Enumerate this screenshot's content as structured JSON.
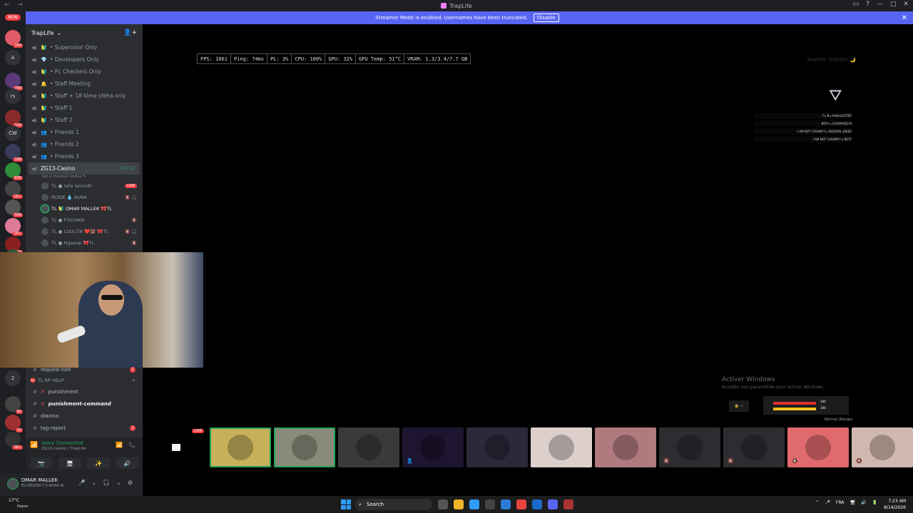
{
  "window": {
    "title": "TrapLife",
    "nav": "← →",
    "controls": [
      "▭",
      "?",
      "—",
      "□",
      "✕"
    ]
  },
  "banner": {
    "text": "Streamer Mode is enabled. Usernames have been truncated.",
    "button": "Disable",
    "close": "✕"
  },
  "guilds": {
    "new_label": "NEW",
    "items": [
      {
        "label": "",
        "badge": "164",
        "color": "#e05c6a"
      },
      {
        "label": "A",
        "badge": "",
        "color": "#313338"
      },
      {
        "label": "",
        "badge": "268",
        "color": "#5b3a7a"
      },
      {
        "label": "rs",
        "badge": "",
        "color": "#313338"
      },
      {
        "label": "",
        "badge": "326",
        "color": "#8a2a2a"
      },
      {
        "label": "CW",
        "badge": "",
        "color": "#313338"
      },
      {
        "label": "",
        "badge": "188",
        "color": "#3a3a5a"
      },
      {
        "label": "",
        "badge": "699",
        "color": "#2e8b3a"
      },
      {
        "label": "",
        "badge": "1K+",
        "color": "#444"
      },
      {
        "label": "",
        "badge": "936",
        "color": "#555"
      },
      {
        "label": "",
        "badge": "1K+",
        "color": "#e07a9a"
      },
      {
        "label": "",
        "badge": "192",
        "color": "#8a2020"
      },
      {
        "label": "",
        "badge": "",
        "color": "#2a5a3a"
      },
      {
        "label": "2",
        "badge": "",
        "color": "#313338"
      },
      {
        "label": "",
        "badge": "90",
        "color": "#444"
      },
      {
        "label": "",
        "badge": "10",
        "color": "#a03030"
      },
      {
        "label": "",
        "badge": "2K+",
        "color": "#333"
      }
    ]
  },
  "server": {
    "name": "TrapLife",
    "chevron": "⌄",
    "invite_icon": "👤+"
  },
  "voice_channels": [
    {
      "label": "Supervisor Only",
      "emoji": "🔰"
    },
    {
      "label": "Developers Only",
      "emoji": "💎"
    },
    {
      "label": "Pc Checkers Only",
      "emoji": "🔰"
    },
    {
      "label": "Staff Meeting",
      "emoji": "🔔"
    },
    {
      "label": "Staff + 18 klme sfeha only",
      "emoji": "🔰"
    },
    {
      "label": "Staff 1",
      "emoji": "🔰"
    },
    {
      "label": "Staff 2",
      "emoji": "🔰"
    },
    {
      "label": "Friends 1",
      "emoji": "👥"
    },
    {
      "label": "Friends 2",
      "emoji": "👥"
    },
    {
      "label": "Friends 3",
      "emoji": "👥"
    }
  ],
  "active_channel": {
    "label": "ZG13-Casino",
    "timer": "1:07:12",
    "status": "Set a channel status ✎"
  },
  "voice_users": [
    {
      "name": "TL ● rafa lamridh",
      "live": "LIVE",
      "mute": ""
    },
    {
      "name": "IR3DE 💧 AURA",
      "live": "",
      "mute": "🔇 🎧"
    },
    {
      "name": "TL 🔰 OMAR MALLEK 🎀TL",
      "live": "",
      "mute": "",
      "speaking": true
    },
    {
      "name": "TL ● FOCHIKA",
      "live": "",
      "mute": "🔇"
    },
    {
      "name": "TL ● LOULITA ❤️🐻 🎀TL",
      "live": "",
      "mute": "🔇 🎧"
    },
    {
      "name": "TL ● Hgaoop 🎀TL",
      "live": "",
      "mute": "🔇"
    }
  ],
  "text_channels_top": [
    {
      "label": "request-role",
      "ping": "1"
    }
  ],
  "category": {
    "label": "TL RP HELP",
    "plus": "+"
  },
  "text_channels": [
    {
      "label": "punishment",
      "x": "✕",
      "bold": false
    },
    {
      "label": "punishment-command",
      "x": "✕",
      "bold": true
    },
    {
      "label": "diwana",
      "x": "",
      "bold": false
    },
    {
      "label": "tag-report",
      "x": "",
      "bold": false,
      "ping": "2"
    }
  ],
  "voicebar": {
    "title": "Voice Connected",
    "subtitle": "ZG13-Casino / TrapLife",
    "controls": [
      "📶",
      "📞"
    ],
    "buttons": [
      "📷",
      "🖥",
      "✨",
      "🔊"
    ]
  },
  "user": {
    "name": "OMAR MALLEK",
    "status": "ELI BEZINA Y JI NHAR W...",
    "controls": [
      "🎤",
      "⌄",
      "🎧",
      "⌄",
      "⚙"
    ]
  },
  "perf": [
    "FPS: 1661",
    "Ping: 74ms",
    "PL: 3%",
    "CPU: 100%",
    "GPU: 32%",
    "GPU Temp: 51°C",
    "VRAM: 1.3/3.4/7.7 GB"
  ],
  "game": {
    "fivem": "FiveM® (b3095) 🌙",
    "logo": "⛛",
    "killfeed": [
      "F.L.B ▸ KHALILSVTER",
      "BOYY ▸ CUADRADO N",
      "-I AM NOT CASAWYY ▸ NAOUFAL JOKER",
      "-I AM NOT CASAWYY ▸ BOYY"
    ],
    "hud_values": [
      "100",
      "100"
    ],
    "hud_small": "🔒 —",
    "mode": "Normal (Range)"
  },
  "windows_activation": {
    "title": "Activer Windows",
    "sub": "Accédez aux paramètres pour activer Windows."
  },
  "tiles": [
    {
      "type": "screen",
      "live": "LIVE",
      "bg": "#000000"
    },
    {
      "type": "avatar",
      "bg": "#c7b05a",
      "speaking": true
    },
    {
      "type": "avatar",
      "bg": "#8a8a7a",
      "speaking": true
    },
    {
      "type": "avatar",
      "bg": "#3a3a3a"
    },
    {
      "type": "avatar",
      "bg": "#1e1530",
      "icon": "👤"
    },
    {
      "type": "avatar",
      "bg": "#2a2a3a"
    },
    {
      "type": "avatar",
      "bg": "#ddd0cc"
    },
    {
      "type": "avatar",
      "bg": "#b07a7e"
    },
    {
      "type": "avatar",
      "bg": "#2b2d31",
      "icon": "🔇"
    },
    {
      "type": "avatar",
      "bg": "#2b2d31",
      "icon": "🔇"
    },
    {
      "type": "avatar",
      "bg": "#e06a6e",
      "icon": "🔇"
    },
    {
      "type": "avatar",
      "bg": "#d0b8ae",
      "icon": "🔇"
    }
  ],
  "taskbar": {
    "weather": "17°C",
    "weather_sub": "Napos",
    "search": "Search",
    "search_icon": "⌕",
    "icons": [
      "#555",
      "#f0b429",
      "#2f9bff",
      "#444",
      "#2f7bd8",
      "#e8453c",
      "#1b6ac9",
      "#5865f2",
      "#aa3333"
    ],
    "tray": [
      "⌃",
      "🎤",
      "FRA",
      "🖥",
      "🔊",
      "🔋"
    ],
    "time": "7:23 AM",
    "date": "8/14/2026"
  }
}
